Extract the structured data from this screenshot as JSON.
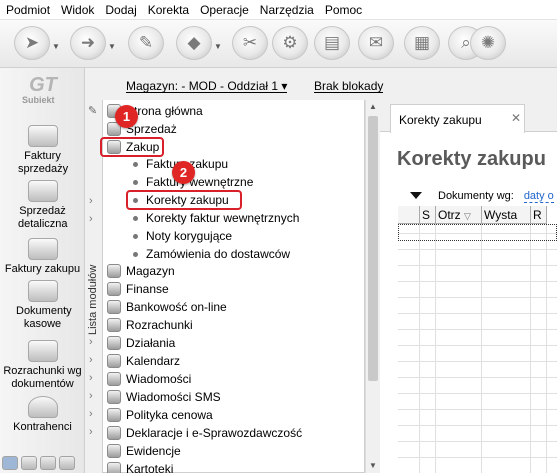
{
  "menubar": [
    "Podmiot",
    "Widok",
    "Dodaj",
    "Korekta",
    "Operacje",
    "Narzędzia",
    "Pomoc"
  ],
  "toolbar": {
    "icons": [
      "send-icon",
      "forward-icon",
      "fiscal-icon",
      "tag-icon",
      "settings-icon",
      "gear-icon",
      "printer-icon",
      "envelope-icon",
      "search-icon",
      "loading-icon"
    ]
  },
  "header": {
    "magazyn": "Magazyn: - MOD - Oddział 1",
    "brak_blokady": "Brak blokady"
  },
  "leftbar": {
    "logo_sub": "Subiekt",
    "items": [
      "Faktury sprzedaży",
      "Sprzedaż detaliczna",
      "Faktury zakupu",
      "Dokumenty kasowe",
      "Rozrachunki wg dokumentów",
      "Kontrahenci"
    ]
  },
  "modules": {
    "side_label": "Lista modułów",
    "items": [
      "Strona główna",
      "Sprzedaż",
      "Zakup",
      "Magazyn",
      "Finanse",
      "Bankowość on-line",
      "Rozrachunki",
      "Działania",
      "Kalendarz",
      "Wiadomości",
      "Wiadomości SMS",
      "Polityka cenowa",
      "Deklaracje i e-Sprawozdawczość",
      "Ewidencje",
      "Kartoteki"
    ],
    "sub_items": [
      "Faktury zakupu",
      "Faktury wewnętrzne",
      "Korekty zakupu",
      "Korekty faktur wewnętrznych",
      "Noty korygujące",
      "Zamówienia do dostawców"
    ]
  },
  "badges": [
    "1",
    "2"
  ],
  "main": {
    "tab_label": "Korekty zakupu",
    "tab_close": "✕",
    "title": "Korekty zakupu",
    "filter_label": "Dokumenty wg:",
    "filter_link": "daty o",
    "columns": [
      "",
      "S",
      "Otrz",
      "Wysta",
      "R"
    ]
  }
}
